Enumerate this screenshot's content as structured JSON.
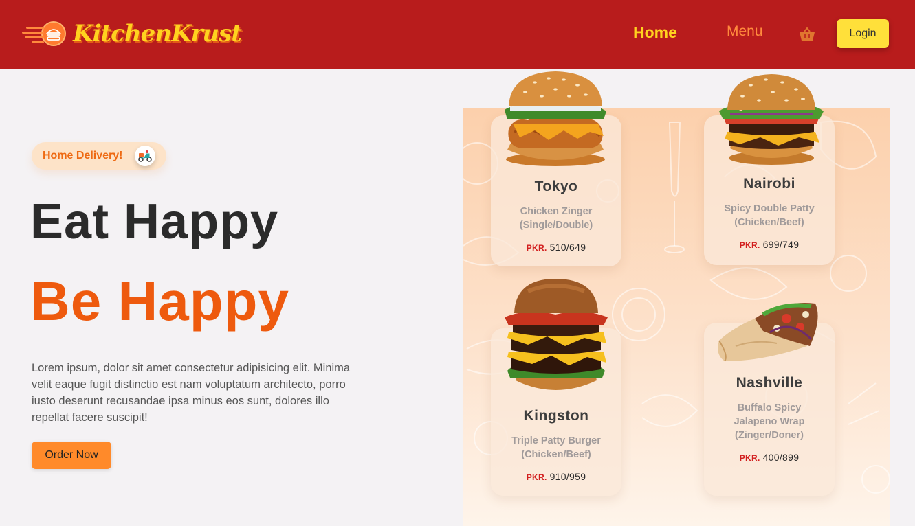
{
  "header": {
    "brand": "KitchenKrust",
    "nav": [
      {
        "label": "Home"
      },
      {
        "label": "Menu"
      }
    ],
    "login_label": "Login"
  },
  "hero": {
    "badge": "Home Delivery!",
    "headline_1": "Eat Happy",
    "headline_2": "Be Happy",
    "description": "Lorem ipsum, dolor sit amet consectetur adipisicing elit. Minima velit eaque fugit distinctio est nam voluptatum architecto, porro iusto deserunt recusandae ipsa minus eos sunt, dolores illo repellat facere suscipit!",
    "cta": "Order Now"
  },
  "menu_cards": [
    {
      "name": "Tokyo",
      "desc_1": "Chicken Zinger",
      "desc_2": "(Single/Double)",
      "currency": "PKR.",
      "price": "510/649"
    },
    {
      "name": "Nairobi",
      "desc_1": "Spicy Double Patty",
      "desc_2": "(Chicken/Beef)",
      "currency": "PKR.",
      "price": "699/749"
    },
    {
      "name": "Kingston",
      "desc_1": "Triple Patty Burger",
      "desc_2": "(Chicken/Beef)",
      "currency": "PKR.",
      "price": "910/959"
    },
    {
      "name": "Nashville",
      "desc_1": "Buffalo Spicy",
      "desc_2": "Jalapeno Wrap",
      "desc_3": "(Zinger/Doner)",
      "currency": "PKR.",
      "price": "400/899"
    }
  ],
  "colors": {
    "nav_bg": "#b81c1c",
    "brand_yellow": "#ffd21f",
    "accent_orange": "#ee5a0e",
    "button_orange": "#ff8a2a",
    "login_yellow": "#ffe03a",
    "price_red": "#d21d1d"
  },
  "icons": {
    "logo": "burger-logo-icon",
    "cart": "basket-icon",
    "delivery": "scooter-icon"
  }
}
